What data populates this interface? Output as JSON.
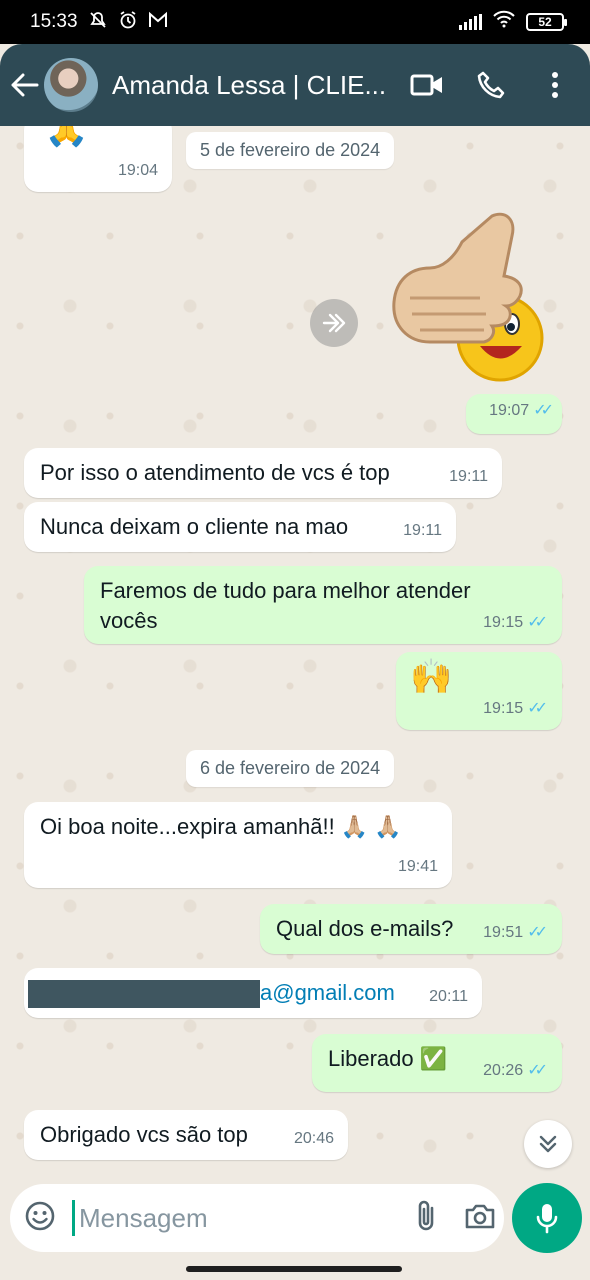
{
  "status_bar": {
    "time": "15:33",
    "battery": "52"
  },
  "header": {
    "contact_name": "Amanda Lessa | CLIE...",
    "back_icon": "arrow-left-icon",
    "video_icon": "video-call-icon",
    "call_icon": "phone-icon",
    "menu_icon": "more-vertical-icon"
  },
  "chat": {
    "messages": [
      {
        "type": "in",
        "text": "🙏",
        "time": "19:04"
      },
      {
        "type": "date",
        "text": "5 de fevereiro de 2024"
      },
      {
        "type": "out-sticker",
        "sticker": "thumbs-up-smiley-sticker",
        "time": "19:07"
      },
      {
        "type": "in",
        "text": "Por isso o atendimento de vcs é top",
        "time": "19:11"
      },
      {
        "type": "in",
        "text": "Nunca deixam o cliente na mao",
        "time": "19:11"
      },
      {
        "type": "out",
        "text": "Faremos de tudo para melhor atender vocês",
        "time": "19:15"
      },
      {
        "type": "out",
        "text": "🙌",
        "time": "19:15"
      },
      {
        "type": "date",
        "text": "6 de fevereiro de 2024"
      },
      {
        "type": "in",
        "text": "Oi boa noite...expira amanhã!! 🙏🏼 🙏🏼",
        "time": "19:41"
      },
      {
        "type": "out",
        "text": "Qual dos e-mails?",
        "time": "19:51"
      },
      {
        "type": "in",
        "text": "a@gmail.com",
        "time": "20:11"
      },
      {
        "type": "out",
        "text": "Liberado ✅",
        "time": "20:26"
      },
      {
        "type": "in",
        "text": "Obrigado vcs são top",
        "time": "20:46"
      }
    ]
  },
  "input": {
    "placeholder": "Mensagem",
    "emoji_icon": "emoji-icon",
    "attach_icon": "paperclip-icon",
    "camera_icon": "camera-icon",
    "mic_icon": "microphone-icon"
  },
  "colors": {
    "header_bg": "#2e4a55",
    "outgoing_bubble": "#d9fdd3",
    "incoming_bubble": "#ffffff",
    "accent": "#00a884",
    "read_ticks": "#53bdeb"
  }
}
